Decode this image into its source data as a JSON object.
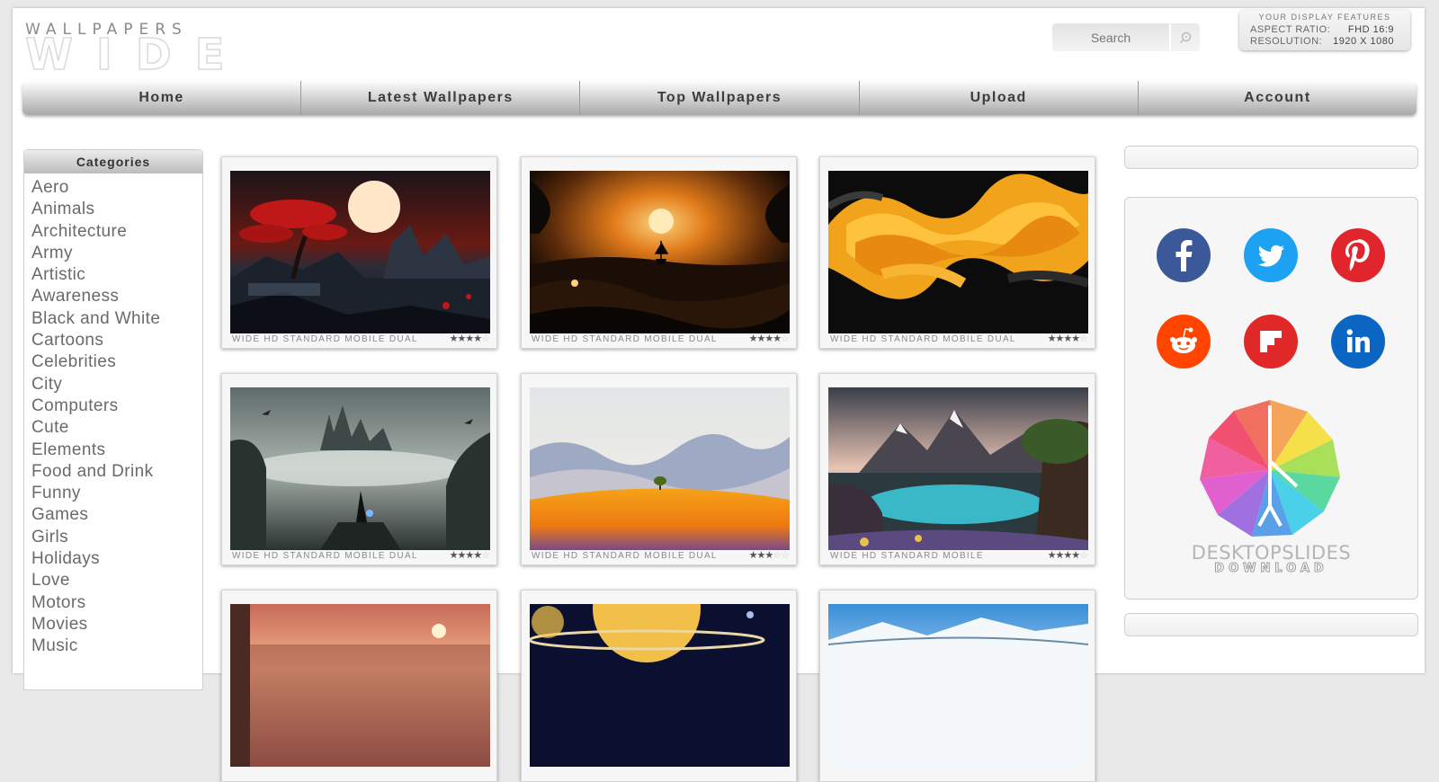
{
  "logo": {
    "top": "WALLPAPERS",
    "bottom": "WIDE"
  },
  "search": {
    "placeholder": "Search"
  },
  "display": {
    "title": "YOUR DISPLAY FEATURES",
    "aspect_label": "ASPECT RATIO:",
    "aspect_value": "FHD 16:9",
    "resolution_label": "RESOLUTION:",
    "resolution_value": "1920 X 1080"
  },
  "nav": {
    "items": [
      "Home",
      "Latest Wallpapers",
      "Top Wallpapers",
      "Upload",
      "Account"
    ]
  },
  "categories": {
    "title": "Categories",
    "items": [
      "Aero",
      "Animals",
      "Architecture",
      "Army",
      "Artistic",
      "Awareness",
      "Black and White",
      "Cartoons",
      "Celebrities",
      "City",
      "Computers",
      "Cute",
      "Elements",
      "Food and Drink",
      "Funny",
      "Games",
      "Girls",
      "Holidays",
      "Love",
      "Motors",
      "Movies",
      "Music"
    ]
  },
  "wallpapers": [
    {
      "tags": "WIDE  HD  STANDARD  MOBILE  DUAL",
      "rating": 3.5,
      "image": "red-tree-moon-landscape"
    },
    {
      "tags": "WIDE  HD  STANDARD  MOBILE  DUAL",
      "rating": 4,
      "image": "ship-sunset-sea"
    },
    {
      "tags": "WIDE  HD  STANDARD  MOBILE  DUAL",
      "rating": 3.5,
      "image": "orange-liquid-abstract"
    },
    {
      "tags": "WIDE  HD  STANDARD  MOBILE  DUAL",
      "rating": 3.5,
      "image": "castle-wizard-cliff"
    },
    {
      "tags": "WIDE  HD  STANDARD  MOBILE  DUAL",
      "rating": 3,
      "image": "minimal-desert-tree"
    },
    {
      "tags": "WIDE  HD  STANDARD  MOBILE",
      "rating": 3.5,
      "image": "mountain-lake-tree"
    },
    {
      "tags": "",
      "rating": 0,
      "image": "sunset-city"
    },
    {
      "tags": "",
      "rating": 0,
      "image": "saturn-space"
    },
    {
      "tags": "",
      "rating": 0,
      "image": "snowy-mountains"
    }
  ],
  "social": [
    {
      "name": "facebook",
      "color": "#3b5998"
    },
    {
      "name": "twitter",
      "color": "#1da1f2"
    },
    {
      "name": "pinterest",
      "color": "#e0252c"
    },
    {
      "name": "reddit",
      "color": "#ff4500"
    },
    {
      "name": "flipboard",
      "color": "#e12828"
    },
    {
      "name": "linkedin",
      "color": "#0a66c2"
    }
  ],
  "desktopslides": {
    "line1": "DESKTOPSLIDES",
    "line2": "DOWNLOAD"
  }
}
